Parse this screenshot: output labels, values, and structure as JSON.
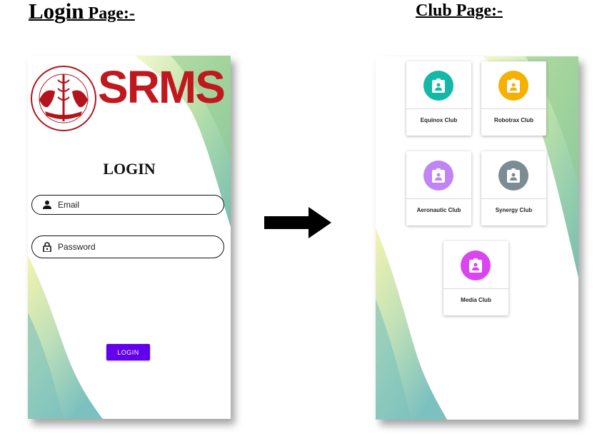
{
  "headings": {
    "login_word": "Login",
    "login_suffix": " Page:-",
    "club": "Club Page:-"
  },
  "login_page": {
    "logo_text": "SRMS",
    "title": "LOGIN",
    "email_placeholder": "Email",
    "password_placeholder": "Password",
    "button_label": "LOGIN",
    "button_color": "#6200ee",
    "logo_color": "#c0181f"
  },
  "club_page": {
    "clubs": [
      {
        "label": "Equinox Club",
        "color": "#14b8a6",
        "icon": "badge-icon"
      },
      {
        "label": "Robotrax Club",
        "color": "#f5b000",
        "icon": "badge-icon"
      },
      {
        "label": "Aeronautic Club",
        "color": "#c084f5",
        "icon": "badge-icon"
      },
      {
        "label": "Synergy Club",
        "color": "#7b8c95",
        "icon": "badge-icon"
      },
      {
        "label": "Media Club",
        "color": "#d946ef",
        "icon": "badge-icon"
      }
    ]
  }
}
